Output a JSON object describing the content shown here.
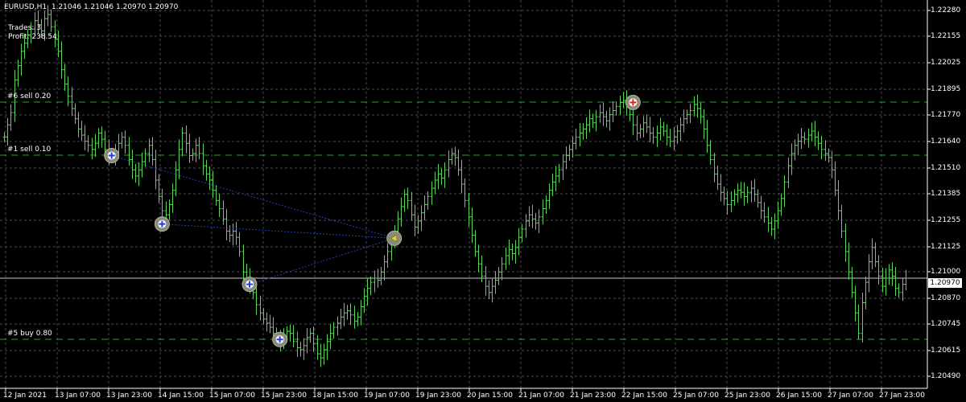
{
  "header": {
    "symbol": "EURUSD,H1",
    "ohlc": "1.21046 1.21046 1.20970 1.20970"
  },
  "stats": {
    "trades": "Trades: 3",
    "profit": "Profit: 238.54"
  },
  "order_lines": [
    {
      "label": "#6 sell 0.20",
      "price": 1.2183
    },
    {
      "label": "#1 sell 0.10",
      "price": 1.2157
    },
    {
      "label": "#5 buy 0.80",
      "price": 1.2067
    }
  ],
  "current_price": {
    "label": "1.20970",
    "price": 1.2097
  },
  "price_axis": {
    "min": 1.2043,
    "max": 1.2228,
    "ticks": [
      "1.22280",
      "1.22155",
      "1.22025",
      "1.21895",
      "1.21770",
      "1.21640",
      "1.21510",
      "1.21385",
      "1.21255",
      "1.21125",
      "1.21000",
      "1.20870",
      "1.20745",
      "1.20615",
      "1.20490"
    ]
  },
  "time_axis": {
    "ticks": [
      "12 Jan 2021",
      "13 Jan 07:00",
      "13 Jan 23:00",
      "14 Jan 15:00",
      "15 Jan 07:00",
      "15 Jan 23:00",
      "18 Jan 15:00",
      "19 Jan 07:00",
      "19 Jan 23:00",
      "20 Jan 15:00",
      "21 Jan 07:00",
      "21 Jan 23:00",
      "22 Jan 15:00",
      "25 Jan 07:00",
      "25 Jan 23:00",
      "26 Jan 15:00",
      "27 Jan 07:00",
      "27 Jan 23:00"
    ]
  },
  "trade_markers": [
    {
      "type": "buy",
      "icon": "blue-circle-marker",
      "bar": 32,
      "price": 1.2157
    },
    {
      "type": "buy",
      "icon": "blue-circle-marker",
      "bar": 47,
      "price": 1.21235
    },
    {
      "type": "buy",
      "icon": "blue-circle-marker",
      "bar": 73,
      "price": 1.2094
    },
    {
      "type": "buy",
      "icon": "blue-circle-marker",
      "bar": 82,
      "price": 1.2067
    },
    {
      "type": "sell",
      "icon": "red-circle-marker",
      "bar": 187,
      "price": 1.2183
    },
    {
      "type": "close",
      "icon": "yellow-triangle-marker",
      "bar": 116,
      "price": 1.21165
    }
  ],
  "colors": {
    "background": "#000000",
    "grid": "#4a4a4a",
    "bars": "#5cd35c",
    "order_line": "#2f9e2f",
    "trade_link": "#1f3fbf",
    "text": "#ffffff"
  },
  "chart_data": {
    "type": "bar",
    "closes": [
      1.2166,
      1.2172,
      1.2178,
      1.2194,
      1.2201,
      1.2208,
      1.2212,
      1.2216,
      1.2219,
      1.2223,
      1.2221,
      1.2218,
      1.2224,
      1.2226,
      1.222,
      1.2214,
      1.2208,
      1.2199,
      1.2192,
      1.2186,
      1.218,
      1.2175,
      1.217,
      1.2167,
      1.2164,
      1.2162,
      1.216,
      1.2163,
      1.2168,
      1.2165,
      1.216,
      1.2157,
      1.2157,
      1.2159,
      1.2163,
      1.2166,
      1.2162,
      1.2155,
      1.215,
      1.2147,
      1.215,
      1.2154,
      1.2158,
      1.2162,
      1.2155,
      1.2145,
      1.2137,
      1.213,
      1.2128,
      1.2133,
      1.214,
      1.215,
      1.216,
      1.2168,
      1.2163,
      1.2157,
      1.2158,
      1.2162,
      1.2158,
      1.2152,
      1.2148,
      1.2145,
      1.214,
      1.2135,
      1.2131,
      1.2126,
      1.212,
      1.2118,
      1.212,
      1.2117,
      1.211,
      1.21,
      1.2097,
      1.2094,
      1.209,
      1.2084,
      1.208,
      1.2077,
      1.2075,
      1.2073,
      1.207,
      1.2068,
      1.2066,
      1.2068,
      1.2071,
      1.207,
      1.2066,
      1.2063,
      1.2062,
      1.2064,
      1.2068,
      1.207,
      1.2065,
      1.206,
      1.2058,
      1.2062,
      1.2066,
      1.207,
      1.2073,
      1.2075,
      1.2078,
      1.208,
      1.2081,
      1.2079,
      1.2076,
      1.2078,
      1.2083,
      1.2088,
      1.2092,
      1.2095,
      1.2097,
      1.2096,
      1.21,
      1.2105,
      1.211,
      1.2115,
      1.212,
      1.2126,
      1.2132,
      1.2138,
      1.2135,
      1.2128,
      1.2122,
      1.2125,
      1.2129,
      1.2133,
      1.2137,
      1.2141,
      1.2145,
      1.2148,
      1.2146,
      1.215,
      1.2155,
      1.2158,
      1.2156,
      1.215,
      1.2143,
      1.2135,
      1.2127,
      1.2118,
      1.211,
      1.2104,
      1.2098,
      1.2093,
      1.209,
      1.2093,
      1.2096,
      1.21,
      1.2104,
      1.2108,
      1.2111,
      1.2109,
      1.2112,
      1.2117,
      1.2121,
      1.2125,
      1.2128,
      1.2126,
      1.2124,
      1.2127,
      1.2131,
      1.2135,
      1.214,
      1.2144,
      1.2147,
      1.215,
      1.2154,
      1.2157,
      1.216,
      1.2163,
      1.2166,
      1.2168,
      1.217,
      1.2172,
      1.2175,
      1.2173,
      1.2176,
      1.2178,
      1.2176,
      1.2174,
      1.2177,
      1.2179,
      1.2181,
      1.2183,
      1.2184,
      1.2181,
      1.2177,
      1.2172,
      1.2168,
      1.217,
      1.2173,
      1.2171,
      1.2168,
      1.2166,
      1.2168,
      1.2171,
      1.2169,
      1.2166,
      1.2164,
      1.2166,
      1.2169,
      1.2172,
      1.2175,
      1.2177,
      1.2179,
      1.2182,
      1.218,
      1.2176,
      1.217,
      1.2162,
      1.2155,
      1.2148,
      1.2143,
      1.2139,
      1.2136,
      1.2133,
      1.2135,
      1.2138,
      1.214,
      1.2139,
      1.2137,
      1.2139,
      1.2141,
      1.2138,
      1.2134,
      1.213,
      1.2127,
      1.2124,
      1.2121,
      1.2125,
      1.213,
      1.2136,
      1.2144,
      1.2152,
      1.2158,
      1.2162,
      1.2164,
      1.2166,
      1.2165,
      1.2167,
      1.2169,
      1.2166,
      1.2163,
      1.216,
      1.2158,
      1.2156,
      1.215,
      1.214,
      1.213,
      1.212,
      1.211,
      1.21,
      1.209,
      1.208,
      1.207,
      1.2085,
      1.2095,
      1.2105,
      1.2112,
      1.2105,
      1.2098,
      1.2093,
      1.2097,
      1.2101,
      1.2098,
      1.2092,
      1.209,
      1.2094,
      1.2097
    ]
  }
}
